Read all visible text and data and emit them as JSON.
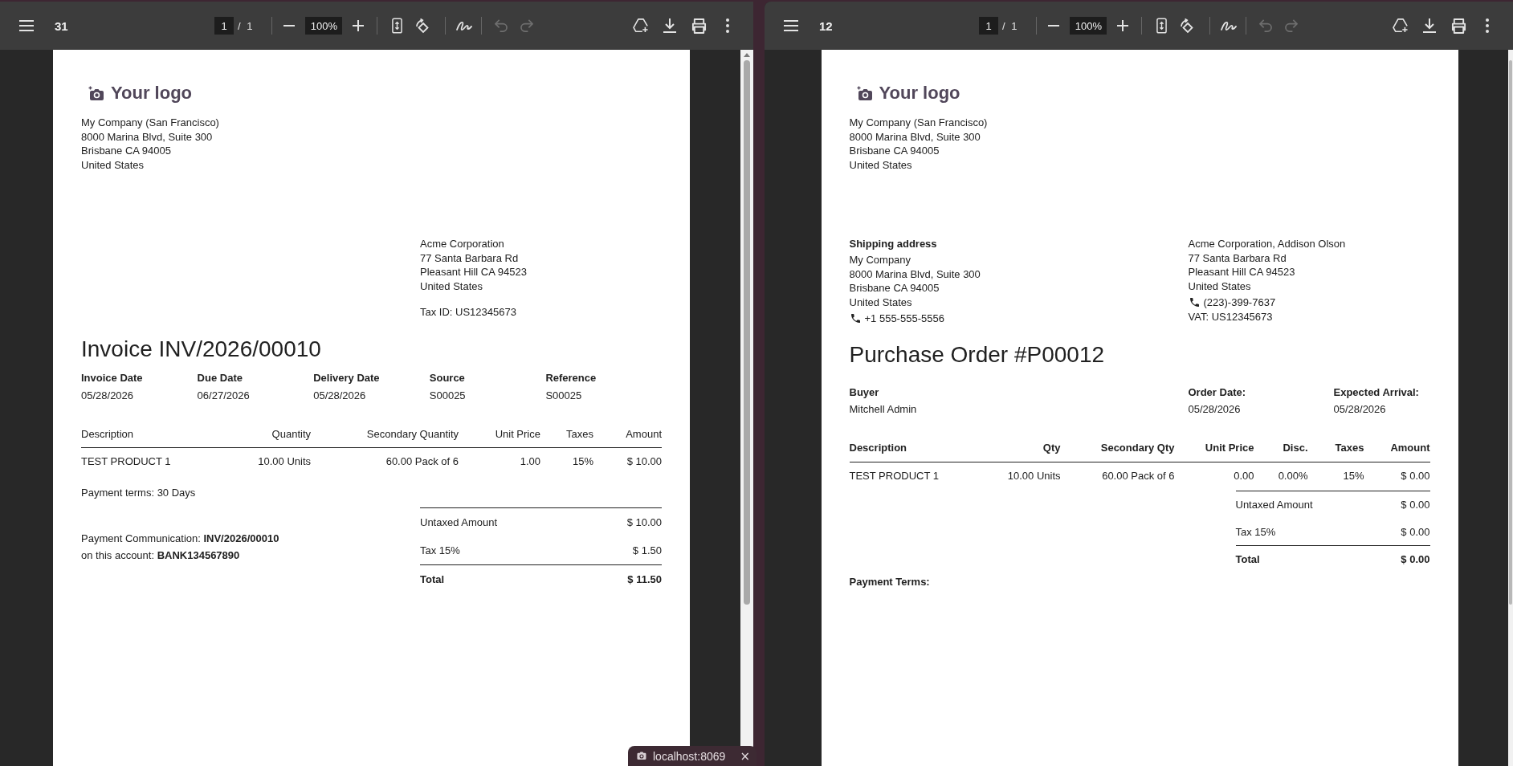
{
  "viewers": [
    {
      "toolbar": {
        "title": "31",
        "page": "1",
        "page_total": "/ 1",
        "zoom": "100%",
        "history": [
          {
            "kind": "undo",
            "disabled": true
          },
          {
            "kind": "redo",
            "disabled": true
          }
        ]
      },
      "document": {
        "kind": "invoice",
        "logo": "Your logo",
        "company": [
          "My Company (San Francisco)",
          "8000 Marina Blvd, Suite 300",
          "Brisbane CA 94005",
          "United States"
        ],
        "partner": {
          "lines": [
            "Acme Corporation",
            "77 Santa Barbara Rd",
            "Pleasant Hill CA 94523",
            "United States"
          ],
          "tax_id": "Tax ID: US12345673"
        },
        "title": "Invoice INV/2026/00010",
        "info": [
          {
            "label": "Invoice Date",
            "value": "05/28/2026"
          },
          {
            "label": "Due Date",
            "value": "06/27/2026"
          },
          {
            "label": "Delivery Date",
            "value": "05/28/2026"
          },
          {
            "label": "Source",
            "value": "S00025"
          },
          {
            "label": "Reference",
            "value": "S00025"
          }
        ],
        "table": {
          "columns": [
            "Description",
            "Quantity",
            "Secondary Quantity",
            "Unit Price",
            "Taxes",
            "Amount"
          ],
          "rows": [
            [
              "TEST PRODUCT 1",
              "10.00 Units",
              "60.00 Pack of 6",
              "1.00",
              "15%",
              "$ 10.00"
            ]
          ]
        },
        "payment_terms": "Payment terms: 30 Days",
        "payment_communication": [
          "Payment Communication: **INV/2026/00010**",
          "on this account: **BANK134567890**"
        ],
        "totals": [
          {
            "kind": "subtotal",
            "label": "Untaxed Amount",
            "value": "$ 10.00"
          },
          {
            "kind": "tax",
            "label": "Tax 15%",
            "value": "$ 1.50"
          },
          {
            "kind": "total",
            "label": "Total",
            "value": "$ 11.50"
          }
        ]
      }
    },
    {
      "toolbar": {
        "title": "12",
        "page": "1",
        "page_total": "/ 1",
        "zoom": "100%",
        "history": [
          {
            "kind": "undo",
            "disabled": true
          },
          {
            "kind": "redo",
            "disabled": true
          }
        ]
      },
      "document": {
        "kind": "purchase_order",
        "logo": "Your logo",
        "company": [
          "My Company (San Francisco)",
          "8000 Marina Blvd, Suite 300",
          "Brisbane CA 94005",
          "United States"
        ],
        "shipping": {
          "heading": "Shipping address",
          "lines": [
            "My Company",
            "8000 Marina Blvd, Suite 300",
            "Brisbane CA 94005",
            "United States"
          ],
          "phone": "+1 555-555-5556"
        },
        "partner": {
          "lines": [
            "Acme Corporation, Addison Olson",
            "77 Santa Barbara Rd",
            "Pleasant Hill CA 94523",
            "United States"
          ],
          "phone": "(223)-399-7637",
          "tax_id": "VAT: US12345673"
        },
        "title": "Purchase Order #P00012",
        "info": [
          {
            "label": "Buyer",
            "value": "Mitchell Admin"
          },
          {
            "label": "Order Date:",
            "value": "05/28/2026"
          },
          {
            "label": "Expected Arrival:",
            "value": "05/28/2026"
          }
        ],
        "table": {
          "columns": [
            "Description",
            "Qty",
            "Secondary Qty",
            "Unit Price",
            "Disc.",
            "Taxes",
            "Amount"
          ],
          "rows": [
            [
              "TEST PRODUCT 1",
              "10.00 Units",
              "60.00 Pack of 6",
              "0.00",
              "0.00%",
              "15%",
              "$ 0.00"
            ]
          ]
        },
        "totals": [
          {
            "kind": "subtotal",
            "label": "Untaxed Amount",
            "value": "$ 0.00"
          },
          {
            "kind": "tax",
            "label": "Tax 15%",
            "value": "$ 0.00"
          },
          {
            "kind": "total",
            "label": "Total",
            "value": "$ 0.00"
          }
        ],
        "payment_terms": "Payment Terms:"
      }
    }
  ],
  "notification": {
    "text": "localhost:8069",
    "close": "×"
  }
}
